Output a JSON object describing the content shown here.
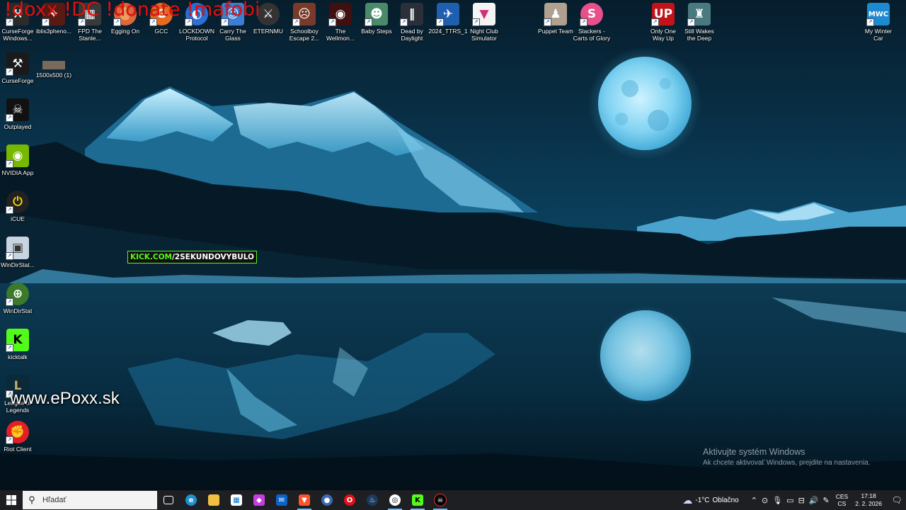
{
  "overlay": {
    "commands": "!doxx !DC !donate !mafobi",
    "kick_part1": "KICK.COM",
    "kick_part2": "/2SEKUNDOVYBULO",
    "website": "www.ePoxx.sk"
  },
  "desktop_icons": {
    "curseforge_windows": "CurseForge\nWindows...",
    "iblis": "iblis3pheno...",
    "fpd": "FPD The\nStanle...",
    "egging_on": "Egging On",
    "gcc": "GCC",
    "lockdown": "LOCKDOWN\nProtocol",
    "carry_glass": "Carry The\nGlass",
    "eternmu": "ETERNMU",
    "schoolboy": "Schoolboy\nEscape 2...",
    "wellmon": "The\nWellmon...",
    "baby_steps": "Baby Steps",
    "dead_by_daylight": "Dead by\nDaylight",
    "ttrs": "2024_TTRS_1",
    "night_club": "Night Club\nSimulator",
    "puppet_team": "Puppet Team",
    "slackers": "Slackers -\nCarts of Glory",
    "only_one_way": "Only One\nWay Up",
    "still_wakes": "Still Wakes\nthe Deep",
    "my_winter_car": "My Winter\nCar",
    "curseforge": "CurseForge",
    "image_1500": "1500x500 (1)",
    "outplayed": "Outplayed",
    "nvidia_app": "NVIDIA App",
    "icue": "iCUE",
    "windirstat_shortcut": "WinDirStat...",
    "windirstat": "WinDirStat",
    "kicktalk": "kicktalk",
    "league": "League of\nLegends",
    "riot_client": "Riot Client"
  },
  "activation": {
    "title": "Aktivujte systém Windows",
    "subtitle": "Ak chcete aktivovať Windows, prejdite na nastavenia."
  },
  "taskbar": {
    "search_placeholder": "Hľadať",
    "weather_temp": "-1°C",
    "weather_text": "Oblačno",
    "lang_top": "CES",
    "lang_bottom": "CS",
    "time": "17:18",
    "date": "2. 2. 2026"
  },
  "colors": {
    "overlay_red": "#e01010",
    "kick_green": "#53fc18",
    "taskbar_bg": "#1e1f22",
    "sky": "#0a3a55"
  }
}
